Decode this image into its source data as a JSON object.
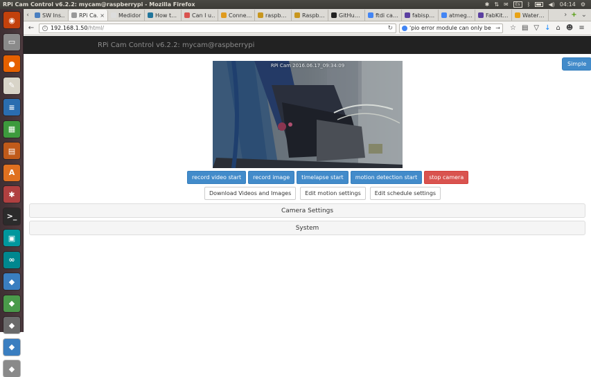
{
  "os": {
    "window_title": "RPi Cam Control v6.2.2: mycam@raspberrypi - Mozilla Firefox",
    "keyboard_layout": "Es",
    "clock": "04:14"
  },
  "launcher": {
    "items": [
      {
        "name": "ubuntu-dash-icon",
        "glyph": "◉",
        "color": "#c2410c"
      },
      {
        "name": "files-icon",
        "glyph": "▭",
        "color": "#8a8a8a"
      },
      {
        "name": "firefox-icon",
        "glyph": "●",
        "color": "#e66000"
      },
      {
        "name": "text-editor-icon",
        "glyph": "✎",
        "color": "#d8d4c8"
      },
      {
        "name": "writer-icon",
        "glyph": "≡",
        "color": "#2a6db0"
      },
      {
        "name": "calc-icon",
        "glyph": "▦",
        "color": "#3d9a3d"
      },
      {
        "name": "impress-icon",
        "glyph": "▤",
        "color": "#c05a1a"
      },
      {
        "name": "software-center-icon",
        "glyph": "A",
        "color": "#e07020"
      },
      {
        "name": "settings-icon",
        "glyph": "✱",
        "color": "#b04040"
      },
      {
        "name": "terminal-icon",
        "glyph": ">_",
        "color": "#2b2b2b"
      },
      {
        "name": "arduino-icon",
        "glyph": "▣",
        "color": "#00979d"
      },
      {
        "name": "arduino-ide-icon",
        "glyph": "∞",
        "color": "#00878f"
      },
      {
        "name": "app-icon-13",
        "glyph": "◆",
        "color": "#3a7ec0"
      },
      {
        "name": "app-icon-14",
        "glyph": "◆",
        "color": "#4a9a4a"
      },
      {
        "name": "app-icon-15",
        "glyph": "◆",
        "color": "#6a6a6a"
      },
      {
        "name": "app-icon-16",
        "glyph": "◆",
        "color": "#3a7ec0"
      },
      {
        "name": "app-icon-17",
        "glyph": "◆",
        "color": "#8a8a8a"
      }
    ]
  },
  "browser": {
    "tabs": [
      {
        "label": "SW Ins…",
        "favicon": "#4a7fc0",
        "active": false
      },
      {
        "label": "RPi Ca…",
        "favicon": "#999999",
        "active": true,
        "close": "×"
      },
      {
        "label": "Medidor …",
        "favicon": "#dddddd",
        "active": false
      },
      {
        "label": "How t…",
        "favicon": "#21759b",
        "active": false
      },
      {
        "label": "Can I u…",
        "favicon": "#d9534f",
        "active": false
      },
      {
        "label": "Conne…",
        "favicon": "#e09b1e",
        "active": false
      },
      {
        "label": "raspb…",
        "favicon": "#c8961e",
        "active": false
      },
      {
        "label": "Raspb…",
        "favicon": "#c8961e",
        "active": false
      },
      {
        "label": "GitHu…",
        "favicon": "#222222",
        "active": false
      },
      {
        "label": "ftdi ca…",
        "favicon": "#4285f4",
        "active": false
      },
      {
        "label": "fabisp…",
        "favicon": "#5b3fa0",
        "active": false
      },
      {
        "label": "atmeg…",
        "favicon": "#4285f4",
        "active": false
      },
      {
        "label": "FabKit…",
        "favicon": "#5b3fa0",
        "active": false
      },
      {
        "label": "Water…",
        "favicon": "#e8a317",
        "active": false
      }
    ],
    "url_host": "192.168.1.50",
    "url_path": "/html/",
    "search_value": "'pio error module can only be run on"
  },
  "page": {
    "header_title": "RPi Cam Control v6.2.2: mycam@raspberrypi",
    "simple_button": "Simple",
    "preview_caption": "RPi Cam  2016.06.17_09:34:09",
    "row1_buttons": [
      {
        "name": "record-video-start-button",
        "label": "record video start",
        "style": "primary"
      },
      {
        "name": "record-image-button",
        "label": "record image",
        "style": "primary"
      },
      {
        "name": "timelapse-start-button",
        "label": "timelapse start",
        "style": "primary"
      },
      {
        "name": "motion-detection-start-button",
        "label": "motion detection start",
        "style": "primary"
      },
      {
        "name": "stop-camera-button",
        "label": "stop camera",
        "style": "danger"
      }
    ],
    "row2_buttons": [
      {
        "name": "download-videos-images-button",
        "label": "Download Videos and Images"
      },
      {
        "name": "edit-motion-settings-button",
        "label": "Edit motion settings"
      },
      {
        "name": "edit-schedule-settings-button",
        "label": "Edit schedule settings"
      }
    ],
    "panels": {
      "camera_settings": "Camera Settings",
      "system": "System"
    }
  },
  "colors": {
    "primary": "#428bca",
    "danger": "#d9534f",
    "header_bg": "#222222"
  }
}
